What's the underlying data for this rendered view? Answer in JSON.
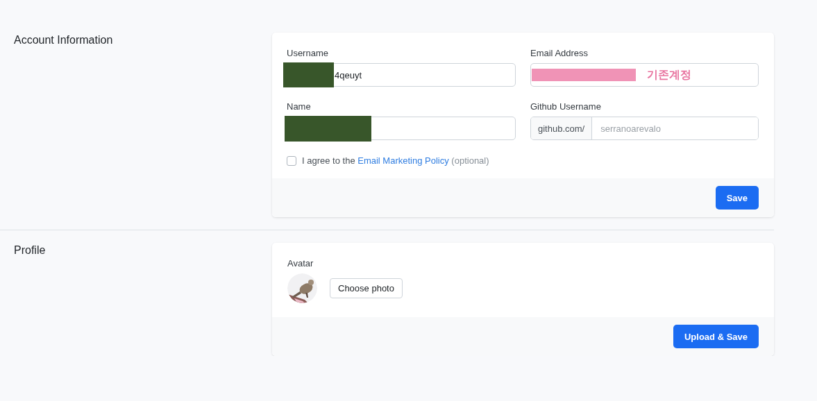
{
  "sections": [
    {
      "title": "Account Information",
      "kind": "account",
      "fields": [
        {
          "label": "Username",
          "value": "4qeuyt",
          "color": "#38562a"
        },
        {
          "label": "Email Address",
          "color": "#f093b6",
          "note": "기존계정"
        },
        {
          "label": "Name",
          "color": "#38562a"
        },
        {
          "label": "Github Username",
          "prefix": "github.com/",
          "placeholder": "serranoarevalo"
        }
      ],
      "consent": {
        "checked": false,
        "text": "I agree to the",
        "link": "Email Marketing Policy",
        "hint": "(optional)"
      },
      "button": "Save"
    },
    {
      "title": "Profile",
      "kind": "profile",
      "avatar_label": "Avatar",
      "choose_button": "Choose photo",
      "button": "Upload & Save"
    }
  ]
}
